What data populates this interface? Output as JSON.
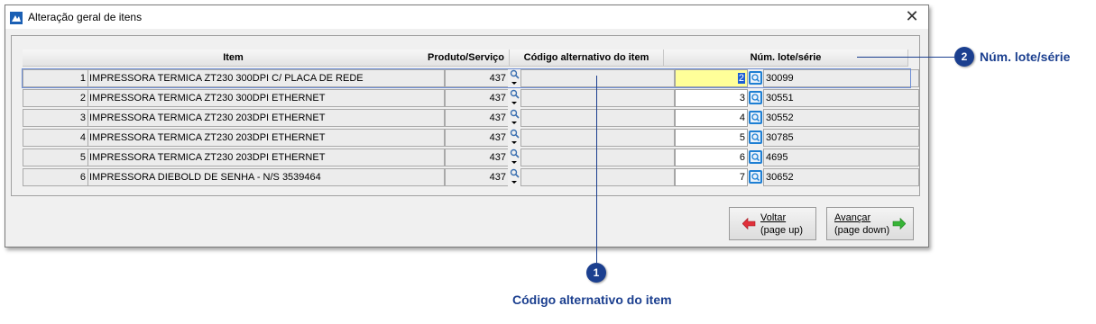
{
  "window": {
    "title": "Alteração geral de itens"
  },
  "grid": {
    "headers": {
      "item": "Item",
      "produto": "Produto/Serviço",
      "codigo_alt": "Código alternativo do item",
      "lote": "Núm. lote/série"
    },
    "rows": [
      {
        "num": "1",
        "item": "IMPRESSORA TERMICA ZT230 300DPI C/ PLACA DE REDE",
        "produto": "437",
        "codigo_alt": "",
        "lote": "2",
        "serie": "30099"
      },
      {
        "num": "2",
        "item": "IMPRESSORA TERMICA ZT230 300DPI ETHERNET",
        "produto": "437",
        "codigo_alt": "",
        "lote": "3",
        "serie": "30551"
      },
      {
        "num": "3",
        "item": "IMPRESSORA TERMICA ZT230 203DPI ETHERNET",
        "produto": "437",
        "codigo_alt": "",
        "lote": "4",
        "serie": "30552"
      },
      {
        "num": "4",
        "item": "IMPRESSORA TERMICA ZT230 203DPI ETHERNET",
        "produto": "437",
        "codigo_alt": "",
        "lote": "5",
        "serie": "30785"
      },
      {
        "num": "5",
        "item": "IMPRESSORA TERMICA ZT230 203DPI ETHERNET",
        "produto": "437",
        "codigo_alt": "",
        "lote": "6",
        "serie": "4695"
      },
      {
        "num": "6",
        "item": "IMPRESSORA DIEBOLD DE SENHA - N/S 3539464",
        "produto": "437",
        "codigo_alt": "",
        "lote": "7",
        "serie": "30652"
      }
    ]
  },
  "buttons": {
    "voltar": {
      "label": "Voltar",
      "hint": "(page up)"
    },
    "avancar": {
      "label": "Avançar",
      "hint": "(page down)"
    }
  },
  "callouts": [
    {
      "num": "1",
      "label": "Código alternativo do item"
    },
    {
      "num": "2",
      "label": "Núm. lote/série"
    }
  ],
  "colors": {
    "callout": "#1b3f8f",
    "selected_cell": "#ffff99",
    "lookup_button": "#1e7fd3",
    "back_arrow": "#e0303a",
    "next_arrow": "#37b437"
  }
}
